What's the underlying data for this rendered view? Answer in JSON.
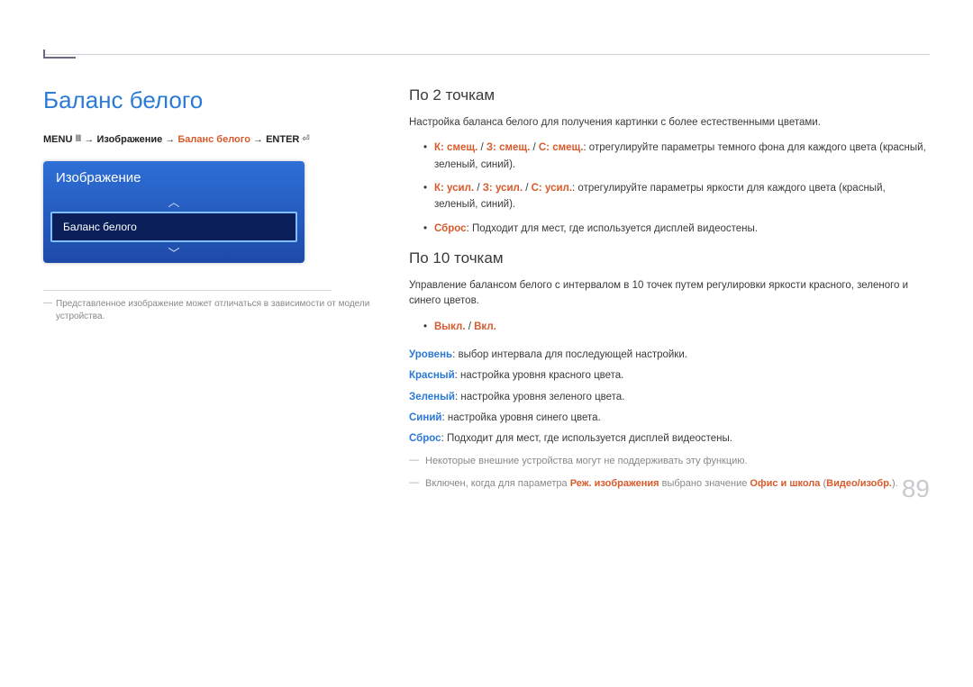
{
  "page": {
    "title": "Баланс белого",
    "number": "89"
  },
  "breadcrumb": {
    "menu": "MENU",
    "sep": " → ",
    "p1": "Изображение",
    "p2": "Баланс белого",
    "enter": "ENTER"
  },
  "menu": {
    "header": "Изображение",
    "selected": "Баланс белого"
  },
  "left_footnote": "Представленное изображение может отличаться в зависимости от модели устройства.",
  "section1": {
    "heading": "По 2 точкам",
    "intro": "Настройка баланса белого для получения картинки с более естественными цветами.",
    "b1_red": "К: смещ.",
    "b1_sep": " / ",
    "b1_red2": "З: смещ.",
    "b1_red3": "С: смещ.",
    "b1_rest": ": отрегулируйте параметры темного фона для каждого цвета (красный, зеленый, синий).",
    "b2_red": "К: усил.",
    "b2_red2": "З: усил.",
    "b2_red3": "С: усил.",
    "b2_rest": ": отрегулируйте параметры яркости для каждого цвета (красный, зеленый, синий).",
    "b3_red": "Сброс",
    "b3_rest": ": Подходит для мест, где используется дисплей видеостены."
  },
  "section2": {
    "heading": "По 10 точкам",
    "intro": "Управление балансом белого с интервалом в 10 точек путем регулировки яркости красного, зеленого и синего цветов.",
    "bullet_off": "Выкл.",
    "bullet_sep": " / ",
    "bullet_on": "Вкл.",
    "d1_label": "Уровень",
    "d1_rest": ": выбор интервала для последующей настройки.",
    "d2_label": "Красный",
    "d2_rest": ": настройка уровня красного цвета.",
    "d3_label": "Зеленый",
    "d3_rest": ": настройка уровня зеленого цвета.",
    "d4_label": "Синий",
    "d4_rest": ": настройка уровня синего цвета.",
    "d5_label": "Сброс",
    "d5_rest": ": Подходит для мест, где используется дисплей видеостены.",
    "note1": "Некоторые внешние устройства могут не поддерживать эту функцию.",
    "note2_pre": "Включен, когда для параметра ",
    "note2_red1": "Реж. изображения",
    "note2_mid": " выбрано значение ",
    "note2_red2": "Офис и школа",
    "note2_paren_open": " (",
    "note2_red3": "Видео/изобр.",
    "note2_paren_close": ")."
  }
}
